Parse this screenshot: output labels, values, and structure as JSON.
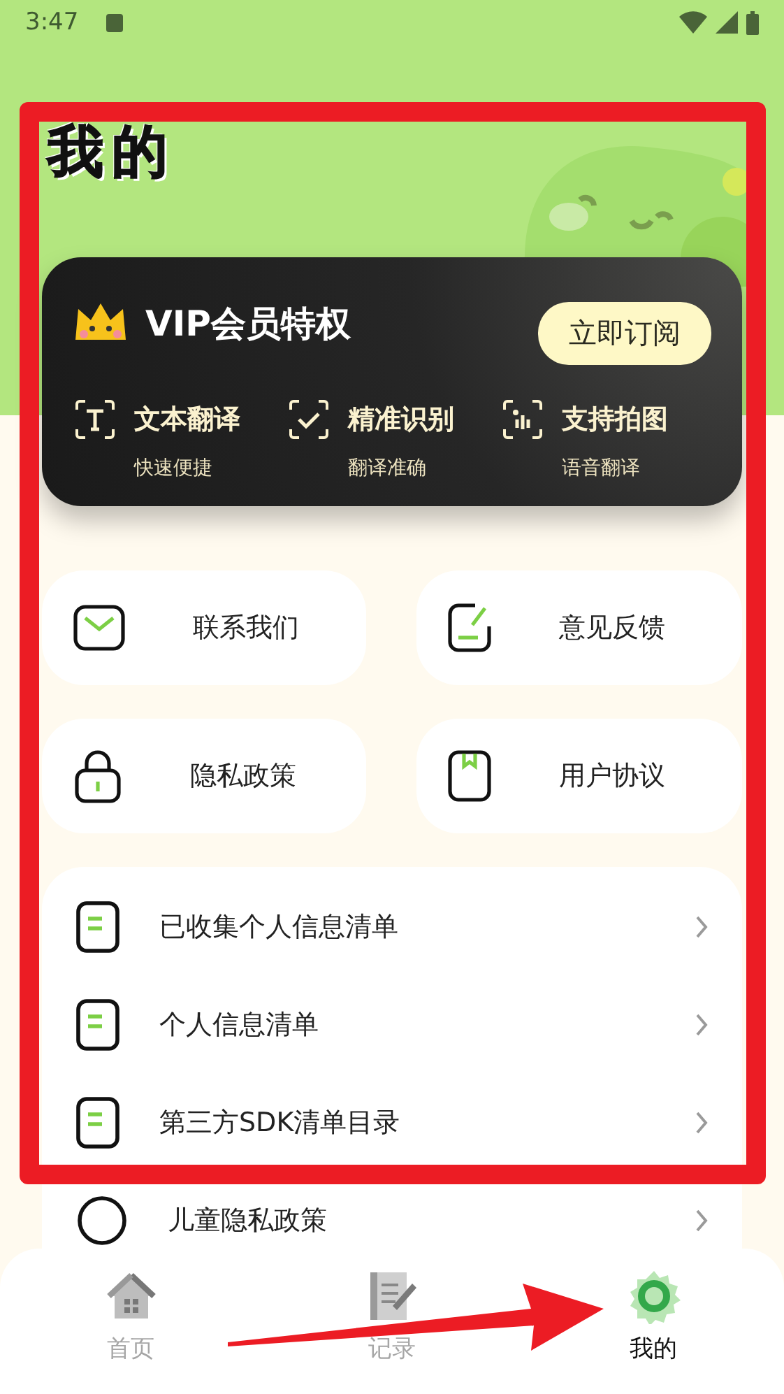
{
  "status_bar": {
    "time": "3:47"
  },
  "title": "我的",
  "vip": {
    "title": "VIP会员特权",
    "button": "立即订阅",
    "features": [
      {
        "kind": "text",
        "title": "文本翻译",
        "subtitle": "快速便捷"
      },
      {
        "kind": "check",
        "title": "精准识别",
        "subtitle": "翻译准确"
      },
      {
        "kind": "camera",
        "title": "支持拍图",
        "subtitle": "语音翻译"
      }
    ]
  },
  "tiles": [
    {
      "kind": "mail",
      "label": "联系我们"
    },
    {
      "kind": "feedback",
      "label": "意见反馈"
    },
    {
      "kind": "lock",
      "label": "隐私政策"
    },
    {
      "kind": "book",
      "label": "用户协议"
    }
  ],
  "list": [
    {
      "kind": "doc",
      "label": "已收集个人信息清单"
    },
    {
      "kind": "doc",
      "label": "个人信息清单"
    },
    {
      "kind": "doc",
      "label": "第三方SDK清单目录"
    },
    {
      "kind": "circle",
      "label": "儿童隐私政策"
    }
  ],
  "nav": [
    {
      "kind": "home",
      "label": "首页",
      "selected": false
    },
    {
      "kind": "notes",
      "label": "记录",
      "selected": false
    },
    {
      "kind": "gear",
      "label": "我的",
      "selected": true
    }
  ]
}
